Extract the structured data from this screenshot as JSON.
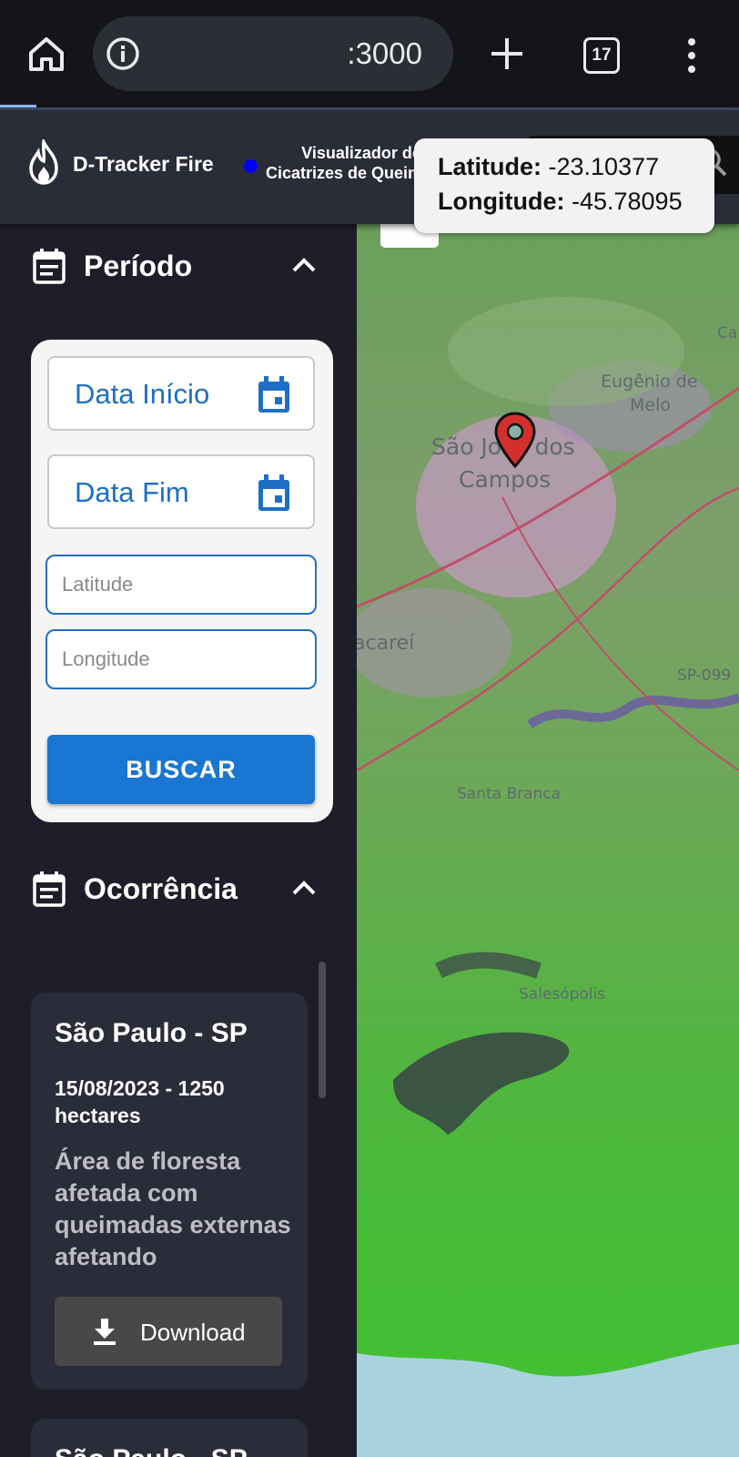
{
  "browser": {
    "url": ":3000",
    "tab_count": "17"
  },
  "header": {
    "brand": "D-Tracker Fire",
    "subtitle_line1": "Visualizador de",
    "subtitle_line2": "Cicatrizes de Queimadas",
    "status_color": "#0000ff"
  },
  "tooltip": {
    "lat_label": "Latitude:",
    "lat_value": "-23.10377",
    "lon_label": "Longitude:",
    "lon_value": "-45.78095"
  },
  "periodo": {
    "title": "Período",
    "date_start": "Data Início",
    "date_end": "Data Fim",
    "latitude_placeholder": "Latitude",
    "longitude_placeholder": "Longitude",
    "search_button": "BUSCAR"
  },
  "ocorrencia": {
    "title": "Ocorrência",
    "items": [
      {
        "city": "São Paulo - SP",
        "meta_line1": "15/08/2023 - 1250",
        "meta_line2": "hectares",
        "description": "Área de floresta afetada com queimadas externas afetando",
        "download_label": "Download"
      },
      {
        "city": "São Paulo - SP"
      }
    ]
  },
  "map": {
    "labels": {
      "sjc1": "São José dos",
      "sjc2": "Campos",
      "eugenio1": "Eugênio de",
      "eugenio2": "Melo",
      "jacarei": "acareí",
      "sp099": "SP-099",
      "santa_branca": "Santa Branca",
      "salesopolis": "Salesópolis",
      "ca": "Ca"
    }
  },
  "colors": {
    "accent": "#1976d2",
    "sidebar_bg": "#1e1e2a",
    "card_bg": "#2b2c39",
    "pin": "#d32f2f"
  }
}
